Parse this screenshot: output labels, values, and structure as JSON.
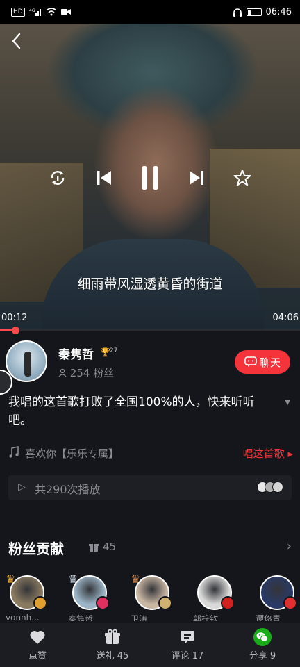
{
  "status_bar": {
    "left_chips": [
      "HD",
      "4G",
      "wifi",
      "video"
    ],
    "time": "06:46"
  },
  "player": {
    "lyric": "细雨带风湿透黄昏的街道",
    "current_time": "00:12",
    "total_time": "04:06",
    "progress": 0.05
  },
  "uploader": {
    "name": "秦隽哲",
    "trophy_count": "27",
    "fans": "254 粉丝",
    "chat_label": "聊天"
  },
  "description": "我唱的这首歌打败了全国100%的人，快来听听吧。",
  "song": {
    "like_text": "喜欢你【乐乐专属】",
    "sing_label": "唱这首歌"
  },
  "plays": {
    "text": "共290次播放"
  },
  "contribution": {
    "title": "粉丝贡献",
    "count": "45",
    "fans": [
      {
        "name": "vonnh...",
        "crown": "gold",
        "avatar_color": "#8a7a60",
        "badge_color": "#e0a030"
      },
      {
        "name": "秦隽哲",
        "crown": "silver",
        "avatar_color": "#9bb4c6",
        "badge_color": "#e03060"
      },
      {
        "name": "卫涛",
        "crown": "bronze",
        "avatar_color": "#c9b6a3",
        "badge_color": "#d0b070"
      },
      {
        "name": "郭梓钦",
        "crown": "",
        "avatar_color": "#d9d9d9",
        "badge_color": "#d02020"
      },
      {
        "name": "谭悠青",
        "crown": "",
        "avatar_color": "#2a3a66",
        "badge_color": "#e03030"
      }
    ]
  },
  "bottom_nav": {
    "like": "点赞",
    "gift": "送礼 45",
    "comment": "评论 17",
    "share": "分享 9"
  },
  "colors": {
    "accent": "#f4333b",
    "background": "#15161b",
    "muted": "#8c8c94"
  }
}
